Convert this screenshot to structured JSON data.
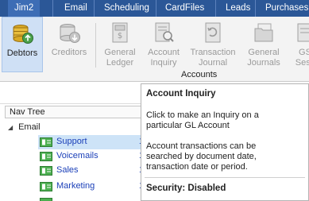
{
  "menu": {
    "items": [
      "Jim2",
      "Email",
      "Scheduling",
      "CardFiles",
      "Leads",
      "Purchases"
    ],
    "active_index": 0
  },
  "ribbon": {
    "buttons": [
      {
        "label_lines": [
          "Debtors"
        ],
        "enabled": true,
        "selected": true,
        "icon": "coins-icon"
      },
      {
        "label_lines": [
          "Creditors"
        ],
        "enabled": false,
        "icon": "coins-icon"
      },
      {
        "label_lines": [
          "General",
          "Ledger"
        ],
        "enabled": false,
        "icon": "ledger-icon"
      },
      {
        "label_lines": [
          "Account",
          "Inquiry"
        ],
        "enabled": false,
        "icon": "inquiry-icon"
      },
      {
        "label_lines": [
          "Transaction",
          "Journal"
        ],
        "enabled": false,
        "icon": "journal-icon"
      },
      {
        "label_lines": [
          "General",
          "Journals"
        ],
        "enabled": false,
        "icon": "folder-icon"
      },
      {
        "label_lines": [
          "GS",
          "Sess"
        ],
        "enabled": false,
        "icon": "session-icon"
      }
    ],
    "group_label": "Accounts"
  },
  "nav_tree": {
    "header": "Nav Tree",
    "parent": "Email",
    "items": [
      {
        "label": "Support",
        "value": "1",
        "selected": true
      },
      {
        "label": "Voicemails",
        "value": "1"
      },
      {
        "label": "Sales",
        "value": "1"
      },
      {
        "label": "Marketing",
        "value": "1"
      }
    ]
  },
  "tooltip": {
    "title": "Account Inquiry",
    "line1": "Click to make an Inquiry on a",
    "line2": "particular GL Account",
    "line3": "Account transactions can be",
    "line4": "searched by document date,",
    "line5": "transaction date or period.",
    "security": "Security: Disabled"
  },
  "colors": {
    "menubar": "#2b5797",
    "link": "#1a3fb8",
    "selection": "#cde3f7"
  }
}
